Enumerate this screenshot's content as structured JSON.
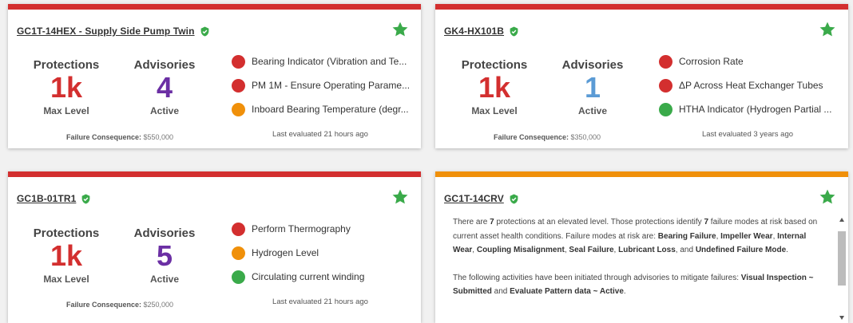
{
  "colors": {
    "critical": "#d32f2f",
    "warning": "#f0900a",
    "ok": "#3aaa4a",
    "star": "#3aaa4a",
    "advisories_purple": "#6b2fa4",
    "advisories_blue": "#5b9bd5"
  },
  "cards": [
    {
      "title": "GC1T-14HEX - Supply Side Pump Twin",
      "protections": {
        "label": "Protections",
        "value": "1k",
        "sub": "Max Level"
      },
      "advisories": {
        "label": "Advisories",
        "value": "4",
        "sub": "Active"
      },
      "consequence_label": "Failure Consequence:",
      "consequence_value": "$550,000",
      "evaluated": "Last evaluated 21 hours ago",
      "items": [
        {
          "status": "red",
          "text": "Bearing Indicator (Vibration and Te..."
        },
        {
          "status": "red",
          "text": "PM 1M - Ensure Operating Parame..."
        },
        {
          "status": "orange",
          "text": "Inboard Bearing Temperature (degr..."
        }
      ]
    },
    {
      "title": "GK4-HX101B",
      "protections": {
        "label": "Protections",
        "value": "1k",
        "sub": "Max Level"
      },
      "advisories": {
        "label": "Advisories",
        "value": "1",
        "sub": "Active"
      },
      "consequence_label": "Failure Consequence:",
      "consequence_value": "$350,000",
      "evaluated": "Last evaluated 3 years ago",
      "items": [
        {
          "status": "red",
          "text": "Corrosion Rate"
        },
        {
          "status": "red",
          "text": "ΔP Across Heat Exchanger Tubes"
        },
        {
          "status": "green",
          "text": "HTHA Indicator (Hydrogen Partial ..."
        }
      ]
    },
    {
      "title": "GC1B-01TR1",
      "protections": {
        "label": "Protections",
        "value": "1k",
        "sub": "Max Level"
      },
      "advisories": {
        "label": "Advisories",
        "value": "5",
        "sub": "Active"
      },
      "consequence_label": "Failure Consequence:",
      "consequence_value": "$250,000",
      "evaluated": "Last evaluated 21 hours ago",
      "items": [
        {
          "status": "red",
          "text": "Perform Thermography"
        },
        {
          "status": "orange",
          "text": "Hydrogen Level"
        },
        {
          "status": "green",
          "text": "Circulating current winding"
        }
      ]
    },
    {
      "title": "GC1T-14CRV",
      "summary": {
        "p1": {
          "t1": "There are ",
          "count1": "7",
          "t2": " protections at an elevated level. Those protections identify ",
          "count2": "7",
          "t3": " failure modes at risk based on current asset health conditions. Failure modes at risk are: ",
          "modes": [
            "Bearing Failure",
            "Impeller Wear",
            "Internal Wear",
            "Coupling Misalignment",
            "Seal Failure",
            "Lubricant Loss"
          ],
          "t4": ", and ",
          "last_mode": "Undefined Failure Mode",
          "t5": "."
        },
        "p2": {
          "t1": "The following activities have been initiated through advisories to mitigate failures: ",
          "activity1": "Visual Inspection ~ Submitted",
          "t2": " and ",
          "activity2": "Evaluate Pattern data ~ Active",
          "t3": "."
        }
      }
    }
  ]
}
